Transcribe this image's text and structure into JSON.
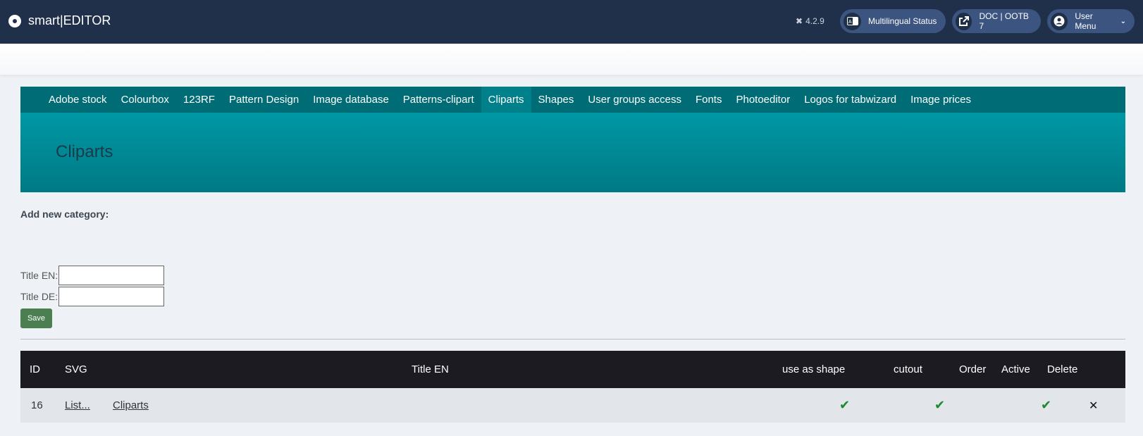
{
  "app": {
    "title": "smart|EDITOR",
    "version": "4.2.9"
  },
  "header_buttons": {
    "multilingual": "Multilingual Status",
    "doc": "DOC | OOTB 7",
    "user_menu": "User Menu"
  },
  "tabs": [
    "Adobe stock",
    "Colourbox",
    "123RF",
    "Pattern Design",
    "Image database",
    "Patterns-clipart",
    "Cliparts",
    "Shapes",
    "User groups access",
    "Fonts",
    "Photoeditor",
    "Logos for tabwizard",
    "Image prices"
  ],
  "active_tab": "Cliparts",
  "page_title": "Cliparts",
  "form": {
    "heading": "Add new category:",
    "title_en_label": "Title EN:",
    "title_en_value": "",
    "title_de_label": "Title DE:",
    "title_de_value": "",
    "save_label": "Save"
  },
  "table": {
    "headers": {
      "id": "ID",
      "svg": "SVG",
      "title": "Title EN",
      "shape": "use as shape",
      "cutout": "cutout",
      "order": "Order",
      "active": "Active",
      "delete": "Delete"
    },
    "rows": [
      {
        "id": "16",
        "svg": "List...",
        "title": "Cliparts",
        "use_as_shape": true,
        "cutout": true,
        "order": "",
        "active": true
      }
    ]
  },
  "icons": {
    "check": "✔",
    "delete": "✕"
  },
  "colors": {
    "topbar": "#20304a",
    "tab_bar": "#006d76",
    "hero": "#0097a4",
    "save": "#4b7f52",
    "check": "#1e8a2e"
  }
}
